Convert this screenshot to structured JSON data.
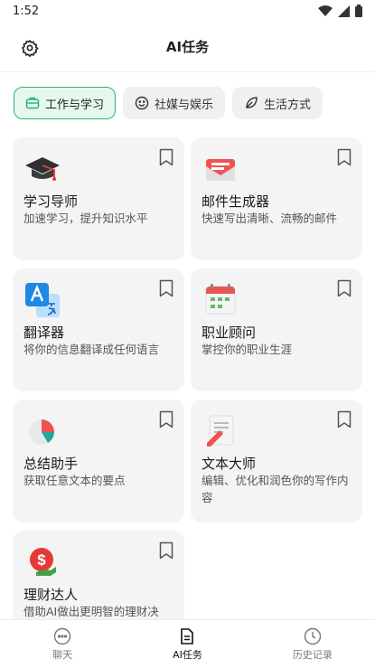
{
  "status": {
    "time": "1:52"
  },
  "header": {
    "title": "AI任务"
  },
  "tabs": [
    {
      "label": "工作与学习",
      "icon": "briefcase-icon",
      "active": true
    },
    {
      "label": "社媒与娱乐",
      "icon": "smiley-icon",
      "active": false
    },
    {
      "label": "生活方式",
      "icon": "leaf-icon",
      "active": false
    }
  ],
  "cards": [
    {
      "title": "学习导师",
      "desc": "加速学习，提升知识水平",
      "icon": "graduation-cap-icon"
    },
    {
      "title": "邮件生成器",
      "desc": "快速写出清晰、流畅的邮件",
      "icon": "email-icon"
    },
    {
      "title": "翻译器",
      "desc": "将你的信息翻译成任何语言",
      "icon": "translate-icon"
    },
    {
      "title": "职业顾问",
      "desc": "掌控你的职业生涯",
      "icon": "calendar-icon"
    },
    {
      "title": "总结助手",
      "desc": "获取任意文本的要点",
      "icon": "pie-chart-icon"
    },
    {
      "title": "文本大师",
      "desc": "编辑、优化和润色你的写作内容",
      "icon": "document-edit-icon"
    },
    {
      "title": "理财达人",
      "desc": "借助AI做出更明智的理财决",
      "icon": "money-icon"
    }
  ],
  "bottom_nav": [
    {
      "label": "聊天",
      "icon": "chat-icon",
      "active": false
    },
    {
      "label": "AI任务",
      "icon": "task-doc-icon",
      "active": true
    },
    {
      "label": "历史记录",
      "icon": "clock-icon",
      "active": false
    }
  ],
  "colors": {
    "accent": "#2bb673",
    "tab_active_bg": "#e6f7ee",
    "card_bg": "#f4f4f4"
  }
}
